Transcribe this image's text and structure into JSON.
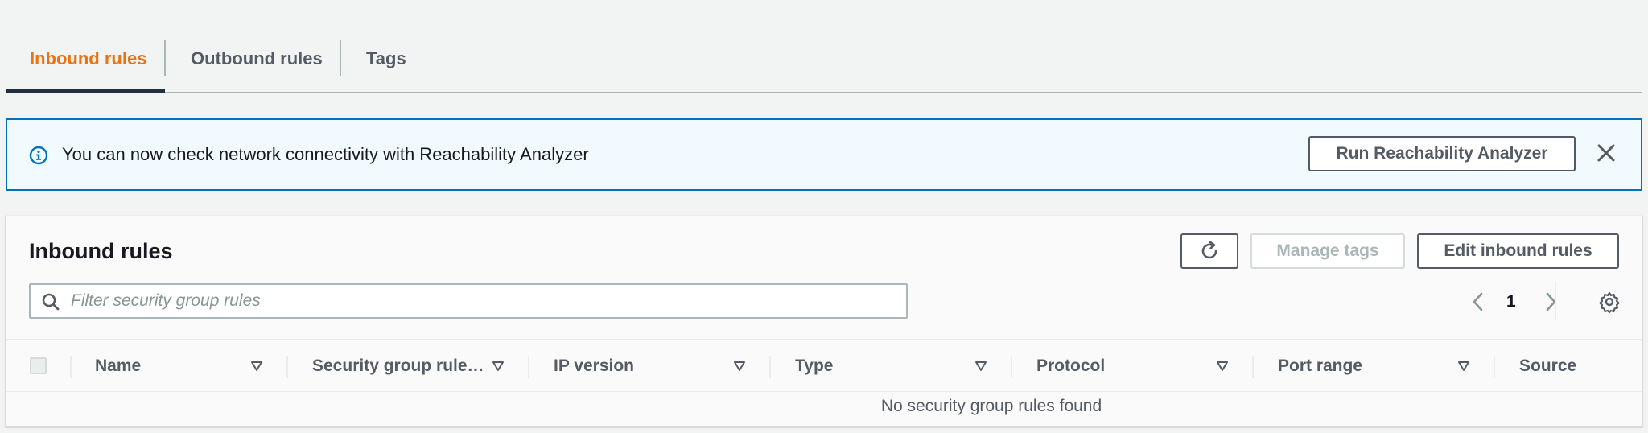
{
  "tabs": [
    {
      "label": "Inbound rules",
      "active": true
    },
    {
      "label": "Outbound rules",
      "active": false
    },
    {
      "label": "Tags",
      "active": false
    }
  ],
  "banner": {
    "icon": "info-icon",
    "message": "You can now check network connectivity with Reachability Analyzer",
    "button_label": "Run Reachability Analyzer",
    "close_icon": "close-icon"
  },
  "panel": {
    "title": "Inbound rules",
    "refresh_icon": "refresh-icon",
    "manage_tags_label": "Manage tags",
    "edit_rules_label": "Edit inbound rules",
    "search": {
      "placeholder": "Filter security group rules",
      "value": ""
    },
    "pagination": {
      "current_page": "1"
    },
    "settings_icon": "gear-icon"
  },
  "table": {
    "columns": [
      "Name",
      "Security group rule…",
      "IP version",
      "Type",
      "Protocol",
      "Port range",
      "Source"
    ],
    "empty_message": "No security group rules found"
  },
  "colors": {
    "accent": "#ec7211",
    "info_blue": "#0073bb",
    "banner_bg": "#f1faff",
    "text": "#16191f",
    "muted": "#545b64"
  }
}
